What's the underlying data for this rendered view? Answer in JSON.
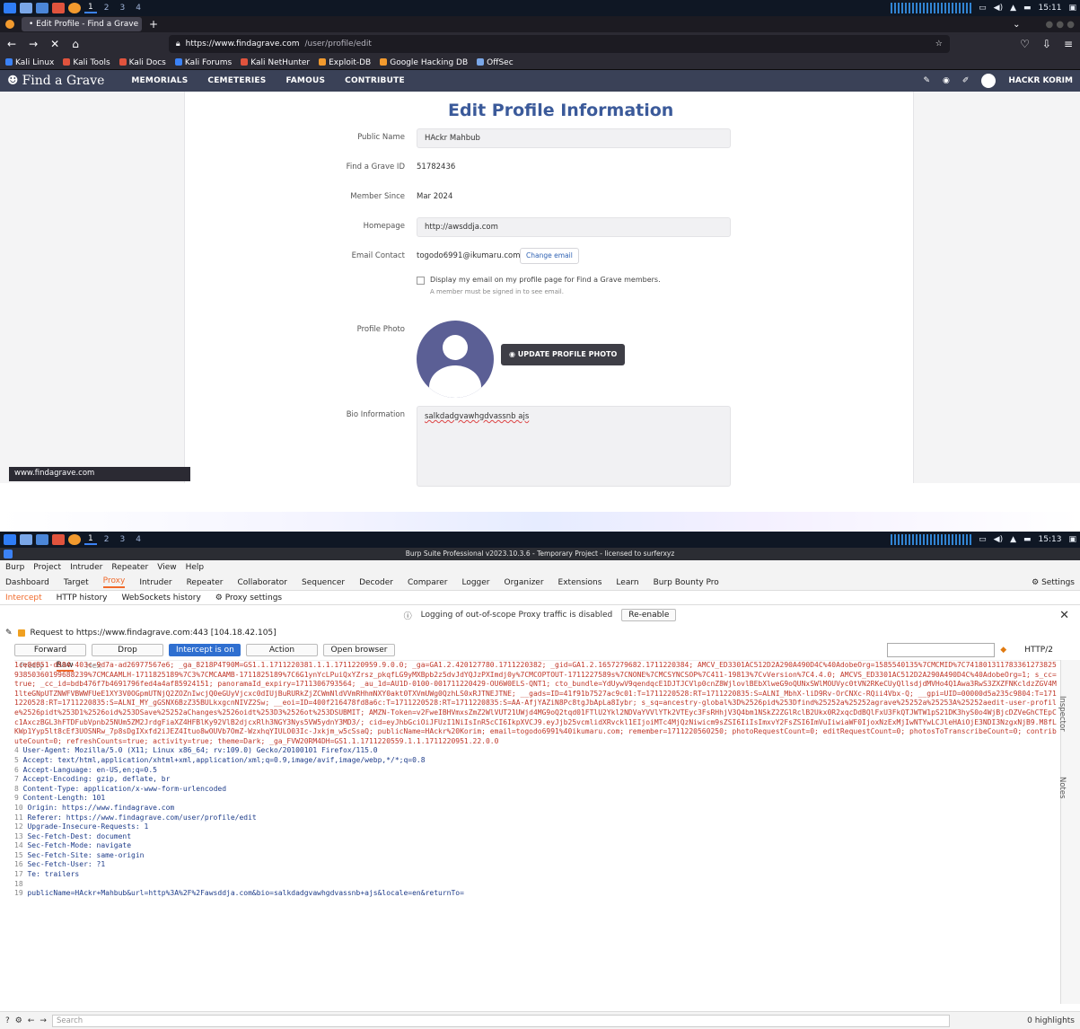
{
  "top": {
    "taskbar": {
      "workspaces": [
        "1",
        "2",
        "3",
        "4"
      ],
      "time": "15:11"
    },
    "firefox": {
      "tab_title": "Edit Profile - Find a Grave",
      "url": "https://www.findagrave.com/user/profile/edit",
      "url_prefix": "https://www.findagrave.com",
      "url_path": "/user/profile/edit",
      "bookmarks": [
        "Kali Linux",
        "Kali Tools",
        "Kali Docs",
        "Kali Forums",
        "Kali NetHunter",
        "Exploit-DB",
        "Google Hacking DB",
        "OffSec"
      ]
    },
    "site": {
      "logo": "Find a Grave",
      "menu": [
        "MEMORIALS",
        "CEMETERIES",
        "FAMOUS",
        "CONTRIBUTE"
      ],
      "user": "HACKR KORIM",
      "title": "Edit Profile Information",
      "fields": {
        "public_name_label": "Public Name",
        "public_name_value": "HAckr Mahbub",
        "id_label": "Find a Grave ID",
        "id_value": "51782436",
        "member_since_label": "Member Since",
        "member_since_value": "Mar 2024",
        "homepage_label": "Homepage",
        "homepage_value": "http://awsddja.com",
        "email_label": "Email Contact",
        "email_value": "togodo6991@ikumaru.com",
        "change_email": "Change email",
        "display_email": "Display my email on my profile page for Find a Grave members.",
        "display_email_hint": "A member must be signed in to see email.",
        "photo_label": "Profile Photo",
        "update_photo": "UPDATE PROFILE PHOTO",
        "bio_label": "Bio Information",
        "bio_value": "salkdadgvawhgdvassnb ajs"
      },
      "status_url": "www.findagrave.com"
    }
  },
  "bottom": {
    "taskbar": {
      "workspaces": [
        "1",
        "2",
        "3",
        "4"
      ],
      "time": "15:13"
    },
    "burp": {
      "title": "Burp Suite Professional v2023.10.3.6 - Temporary Project - licensed to surferxyz",
      "menu": [
        "Burp",
        "Project",
        "Intruder",
        "Repeater",
        "View",
        "Help"
      ],
      "tabs": [
        "Dashboard",
        "Target",
        "Proxy",
        "Intruder",
        "Repeater",
        "Collaborator",
        "Sequencer",
        "Decoder",
        "Comparer",
        "Logger",
        "Organizer",
        "Extensions",
        "Learn",
        "Burp Bounty Pro"
      ],
      "settings": "Settings",
      "subtabs": [
        "Intercept",
        "HTTP history",
        "WebSockets history",
        "Proxy settings"
      ],
      "banner": "Logging of out-of-scope Proxy traffic is disabled",
      "reenable": "Re-enable",
      "request_to": "Request to https://www.findagrave.com:443  [104.18.42.105]",
      "actions": [
        "Forward",
        "Drop",
        "Intercept is on",
        "Action",
        "Open browser"
      ],
      "http_version": "HTTP/2",
      "modes": [
        "Pretty",
        "Raw",
        "Hex"
      ],
      "side_tabs": [
        "Inspector",
        "Notes"
      ],
      "search_placeholder": "Search",
      "highlights": "0 highlights",
      "lines": [
        {
          "n": "",
          "t": "1ce8d851-d594-403c-9d7a-ad26977567e6; _ga_8218P4T90M=GS1.1.1711220381.1.1.1711220959.9.0.0; _ga=GA1.2.420127780.1711220382; _gid=GA1.2.1657279682.1711220384; AMCV_ED3301AC512D2A290A490D4C%40AdobeOrg=1585540135%7CMCMID%7C74180131178336127382593850360199688239%7CMCAAMLH-1711825189%7C3%7CMCAAMB-1711825189%7C6G1ynYcLPuiQxYZrsz_pkqfLG9yMXBpb2z5dvJdYQJzPXImdj0y%7CMCOPTOUT-1711227589s%7CNONE%7CMCSYNCSOP%7C411-19813%7CvVersion%7C4.4.0; AMCVS_ED3301AC512D2A290A490D4C%40AdobeOrg=1; s_cc=true; _cc_id=bdb476f7b4691796fed4a4af85924151; panoramaId_expiry=1711306793564; _au_1d=AU1D-0100-001711220429-OU6W0ELS-QNT1; cto_bundle=YdUywV9qendqcE1DJTJCVlp0cnZ8WjlovlBEbXlweG9oQUNxSWlMOUVyc0tVN2RKeCUyQllsdjdMVHo4Q1Awa3RwS3ZXZFNKcldzZGV4M1lteGNpUTZNWFVBWWFUeE1XY3V0OGpmUTNjQ2ZOZnIwcjQ0eGUyVjcxc0dIUjBuRURkZjZCWmNldVVmRHhmNXY0akt0TXVmUWg0QzhLS0xRJTNEJTNE; __gads=ID=41f91b7527ac9c01:T=1711220528:RT=1711220835:S=ALNI_MbhX-liD9Rv-OrCNXc-RQii4Vbx-Q; __gpi=UID=00000d5a235c9804:T=1711220528:RT=1711220835:S=ALNI_MY_gGSNX6BzZ35BULkxgcnNIVZ2Sw; __eoi=ID=400f216478fd8a6c:T=1711220528:RT=1711220835:S=AA-AfjYAZiN8Pc8tgJbApLa8Iybr; s_sq=ancestry-global%3D%2526pid%253Dfind%25252a%25252agrave%25252a%25253A%25252aedit-user-profile%2526pidt%253D1%2526oid%253DSave%25252aChanges%2526oidt%253D3%2526ot%253DSUBMIT; AMZN-Token=v2FweIBHVmxsZmZ2WlVUT21UWjd4MG9oQ2tqd01FTlU2Ykl2NDVaYVVlYTk2VTEyc3FsRHhjV3Q4bm1NSkZ2ZGlRclB2Ukx0R2xqcDdBQlFxU3FkQTJWTW1pS21DK3hyS0o4WjBjcDZVeGhCTEpCc1AxczBGL3hFTDFubVpnb25NUm5ZM2JrdgFiaXZ4HFBlKy92VlB2djcxRlh3NGY3Nys5VW5ydnY3MD3/; cid=eyJhbGciOiJFUzI1NiIsInR5cCI6IkpXVCJ9.eyJjb25vcmlidXRvckl1EIjoiMTc4MjQzNiwicm9sZSI6IiIsImxvY2FsZSI6ImVuIiwiaWF0IjoxNzExMjIwNTYwLCJleHAiOjE3NDI3NzgxNjB9.M8fLKWp1Yyp5lt8cEf3UOSNRw_7p8sDgIXxfd2iJEZ4Ituo8wOUVb7OmZ-WzxhqYIULO03Ic-Jxkjm_w5cSsaQ; publicName=HAckr%20Korim; email=togodo6991%40ikumaru.com; remember=1711220560250; photoRequestCount=0; editRequestCount=0; photosToTranscribeCount=0; contributeCount=0; refreshCounts=true; activity=true; theme=Dark; _ga_FVW20RM4DH=GS1.1.1711220559.1.1.1711220951.22.0.0"
        },
        {
          "n": "4",
          "t": "User-Agent: Mozilla/5.0 (X11; Linux x86_64; rv:109.0) Gecko/20100101 Firefox/115.0"
        },
        {
          "n": "5",
          "t": "Accept: text/html,application/xhtml+xml,application/xml;q=0.9,image/avif,image/webp,*/*;q=0.8"
        },
        {
          "n": "6",
          "t": "Accept-Language: en-US,en;q=0.5"
        },
        {
          "n": "7",
          "t": "Accept-Encoding: gzip, deflate, br"
        },
        {
          "n": "8",
          "t": "Content-Type: application/x-www-form-urlencoded"
        },
        {
          "n": "9",
          "t": "Content-Length: 101"
        },
        {
          "n": "10",
          "t": "Origin: https://www.findagrave.com"
        },
        {
          "n": "11",
          "t": "Referer: https://www.findagrave.com/user/profile/edit"
        },
        {
          "n": "12",
          "t": "Upgrade-Insecure-Requests: 1"
        },
        {
          "n": "13",
          "t": "Sec-Fetch-Dest: document"
        },
        {
          "n": "14",
          "t": "Sec-Fetch-Mode: navigate"
        },
        {
          "n": "15",
          "t": "Sec-Fetch-Site: same-origin"
        },
        {
          "n": "16",
          "t": "Sec-Fetch-User: ?1"
        },
        {
          "n": "17",
          "t": "Te: trailers"
        },
        {
          "n": "18",
          "t": ""
        },
        {
          "n": "19",
          "t": "publicName=HAckr+Mahbub&url=http%3A%2F%2Fawsddja.com&bio=salkdadgvawhgdvassnb+ajs&locale=en&returnTo="
        }
      ]
    }
  }
}
